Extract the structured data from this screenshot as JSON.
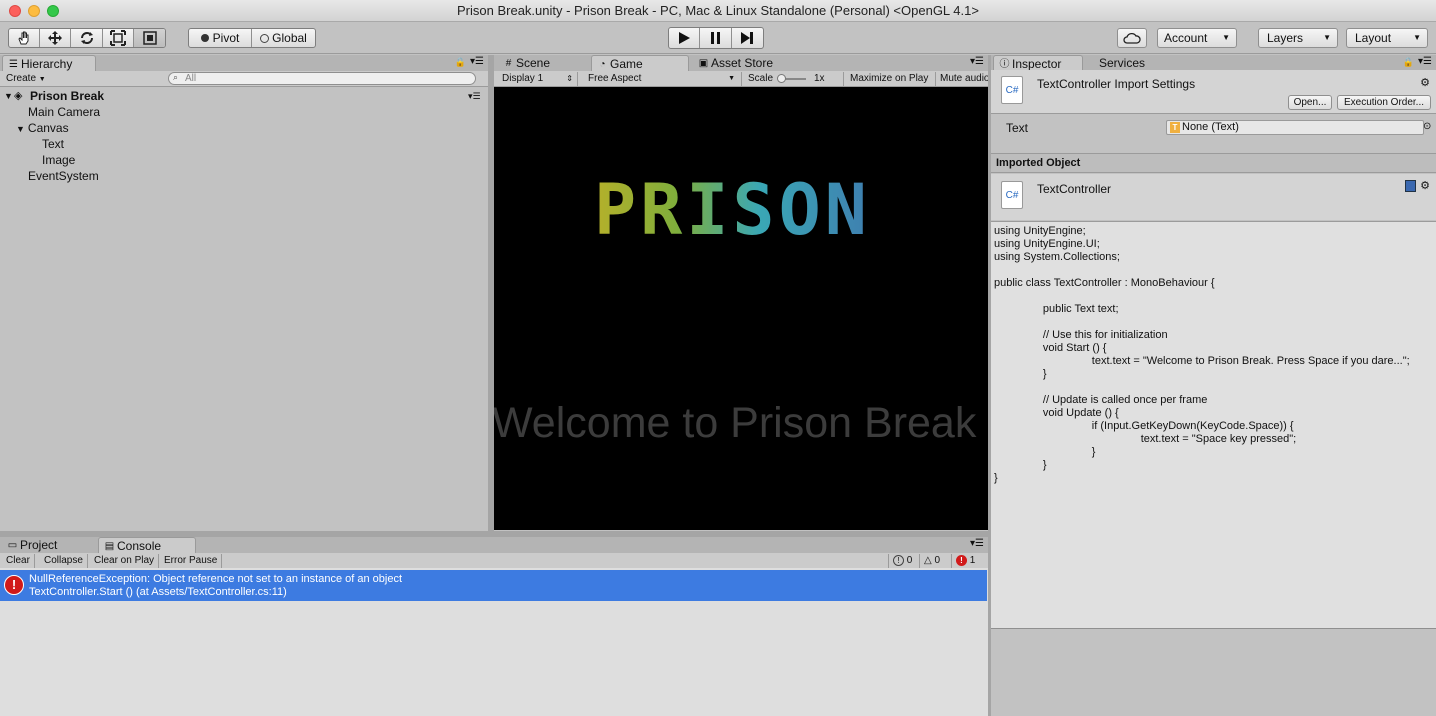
{
  "window": {
    "title": "Prison Break.unity - Prison Break - PC, Mac & Linux Standalone (Personal) <OpenGL 4.1>"
  },
  "toolbar": {
    "tools": [
      "hand-tool",
      "move-tool",
      "rotate-tool",
      "scale-tool",
      "rect-tool"
    ],
    "pivot_label": "Pivot",
    "global_label": "Global",
    "account_label": "Account",
    "layers_label": "Layers",
    "layout_label": "Layout"
  },
  "hierarchy": {
    "tab": "Hierarchy",
    "create_label": "Create",
    "search_placeholder": "All",
    "scene_name": "Prison Break",
    "items": [
      {
        "label": "Main Camera",
        "indent": 1
      },
      {
        "label": "Canvas",
        "indent": 1,
        "expanded": true
      },
      {
        "label": "Text",
        "indent": 2
      },
      {
        "label": "Image",
        "indent": 2
      },
      {
        "label": "EventSystem",
        "indent": 1
      }
    ]
  },
  "center": {
    "tabs": [
      "Scene",
      "Game",
      "Asset Store"
    ],
    "active_tab": "Game",
    "display": "Display 1",
    "aspect": "Free Aspect",
    "scale_label": "Scale",
    "scale_value": "1x",
    "maximize_label": "Maximize on Play",
    "mute_label": "Mute audio",
    "game_title": "PRISON",
    "game_welcome": "Welcome to Prison Break"
  },
  "inspector": {
    "tabs": [
      "Inspector",
      "Services"
    ],
    "header_title": "TextController Import Settings",
    "open_label": "Open...",
    "exec_order_label": "Execution Order...",
    "text_field_label": "Text",
    "text_field_value": "None (Text)",
    "imported_object_label": "Imported Object",
    "script_name": "TextController",
    "code_lines": [
      "using UnityEngine;",
      "using UnityEngine.UI;",
      "using System.Collections;",
      "",
      "public class TextController : MonoBehaviour {",
      "",
      "\t\tpublic Text text;",
      "",
      "\t\t// Use this for initialization",
      "\t\tvoid Start () {",
      "\t\t\t\ttext.text = \"Welcome to Prison Break. Press Space if you dare...\";",
      "\t\t}",
      "",
      "\t\t// Update is called once per frame",
      "\t\tvoid Update () {",
      "\t\t\t\tif (Input.GetKeyDown(KeyCode.Space)) {",
      "\t\t\t\t\t\ttext.text = \"Space key pressed\";",
      "\t\t\t\t}",
      "\t\t}",
      "}"
    ]
  },
  "console": {
    "tabs": [
      "Project",
      "Console"
    ],
    "active_tab": "Console",
    "buttons": [
      "Clear",
      "Collapse",
      "Clear on Play",
      "Error Pause"
    ],
    "log_count": "0",
    "warn_count": "0",
    "error_count": "1",
    "error_line1": "NullReferenceException: Object reference not set to an instance of an object",
    "error_line2": "TextController.Start () (at Assets/TextController.cs:11)"
  },
  "colors": {
    "selection": "#3d7be1",
    "error_red": "#d11a1a"
  }
}
